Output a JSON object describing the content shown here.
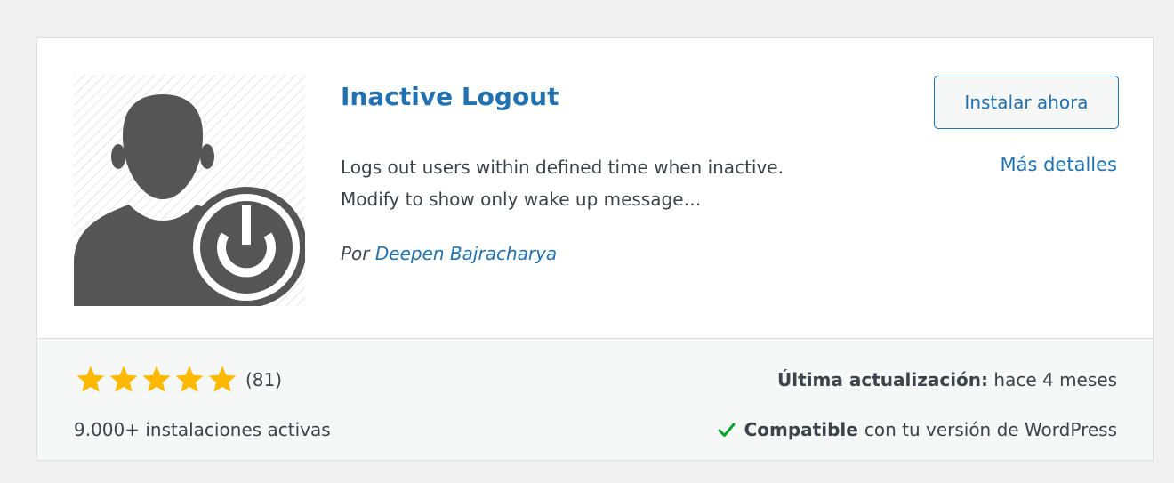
{
  "plugin": {
    "title": "Inactive Logout",
    "description_line1": "Logs out users within defined time when inactive.",
    "description_line2": "Modify to show only wake up message…",
    "author_prefix": "Por",
    "author_name": "Deepen Bajracharya",
    "icon": "user-power-icon"
  },
  "actions": {
    "install_label": "Instalar ahora",
    "more_details_label": "Más detalles"
  },
  "footer": {
    "rating_stars": 5,
    "rating_max": 5,
    "rating_count": "(81)",
    "active_installs": "9.000+ instalaciones activas",
    "last_updated_label": "Última actualización:",
    "last_updated_value": "hace 4 meses",
    "compatible_label": "Compatible",
    "compatible_text": "con tu versión de WordPress"
  },
  "colors": {
    "accent": "#2271b1",
    "star": "#ffb900",
    "check": "#00a32a",
    "text": "#3c434a",
    "icon_dark": "#555555"
  }
}
